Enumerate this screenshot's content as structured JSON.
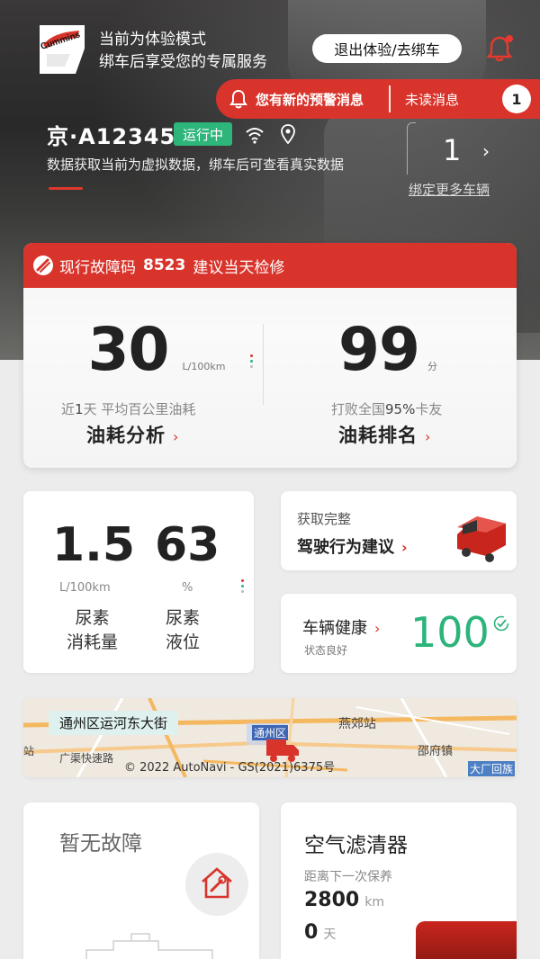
{
  "header": {
    "brand_logo_text": "Cummins",
    "mode_line1": "当前为体验模式",
    "mode_line2": "绑车后享受您的专属服务",
    "exit_button": "退出体验/去绑车"
  },
  "alert": {
    "text": "您有新的预警消息",
    "unread_label": "未读消息",
    "unread_count": "1"
  },
  "vehicle": {
    "plate": "京·A12345",
    "status": "运行中",
    "virtual_note": "数据获取当前为虚拟数据，绑车后可查看真实数据",
    "bound_count": "1",
    "bind_more": "绑定更多车辆"
  },
  "fault": {
    "prefix": "现行故障码",
    "code": "8523",
    "advice": "建议当天检修"
  },
  "fuel": {
    "value": "30",
    "unit": "L/100km",
    "caption_prefix": "近",
    "caption_days": "1",
    "caption_suffix": "天 平均百公里油耗",
    "link": "油耗分析"
  },
  "ranking": {
    "value": "99",
    "unit": "分",
    "caption_prefix": "打败全国",
    "caption_percent": "95%",
    "caption_suffix": "卡友",
    "link": "油耗排名"
  },
  "urea": {
    "consumption_value": "1.5",
    "consumption_unit": "L/100km",
    "consumption_label_l1": "尿素",
    "consumption_label_l2": "消耗量",
    "level_value": "63",
    "level_unit": "%",
    "level_label_l1": "尿素",
    "level_label_l2": "液位"
  },
  "driving": {
    "line1": "获取完整",
    "line2": "驾驶行为建议"
  },
  "health": {
    "title": "车辆健康",
    "status": "状态良好",
    "score": "100"
  },
  "map": {
    "location": "通州区运河东大街",
    "copyright": "© 2022 AutoNavi - GS(2021)6375号",
    "labels": [
      "通州区",
      "燕郊站",
      "邵府镇",
      "大厂回族",
      "广渠快速路",
      "站"
    ]
  },
  "no_fault": {
    "title": "暂无故障"
  },
  "air_filter": {
    "title": "空气滤清器",
    "subtitle": "距离下一次保养",
    "distance": "2800",
    "distance_unit": "km",
    "days": "0",
    "days_unit": "天"
  },
  "colors": {
    "accent_red": "#d8342c",
    "status_green": "#2db57a",
    "score_green": "#2cb47b"
  }
}
